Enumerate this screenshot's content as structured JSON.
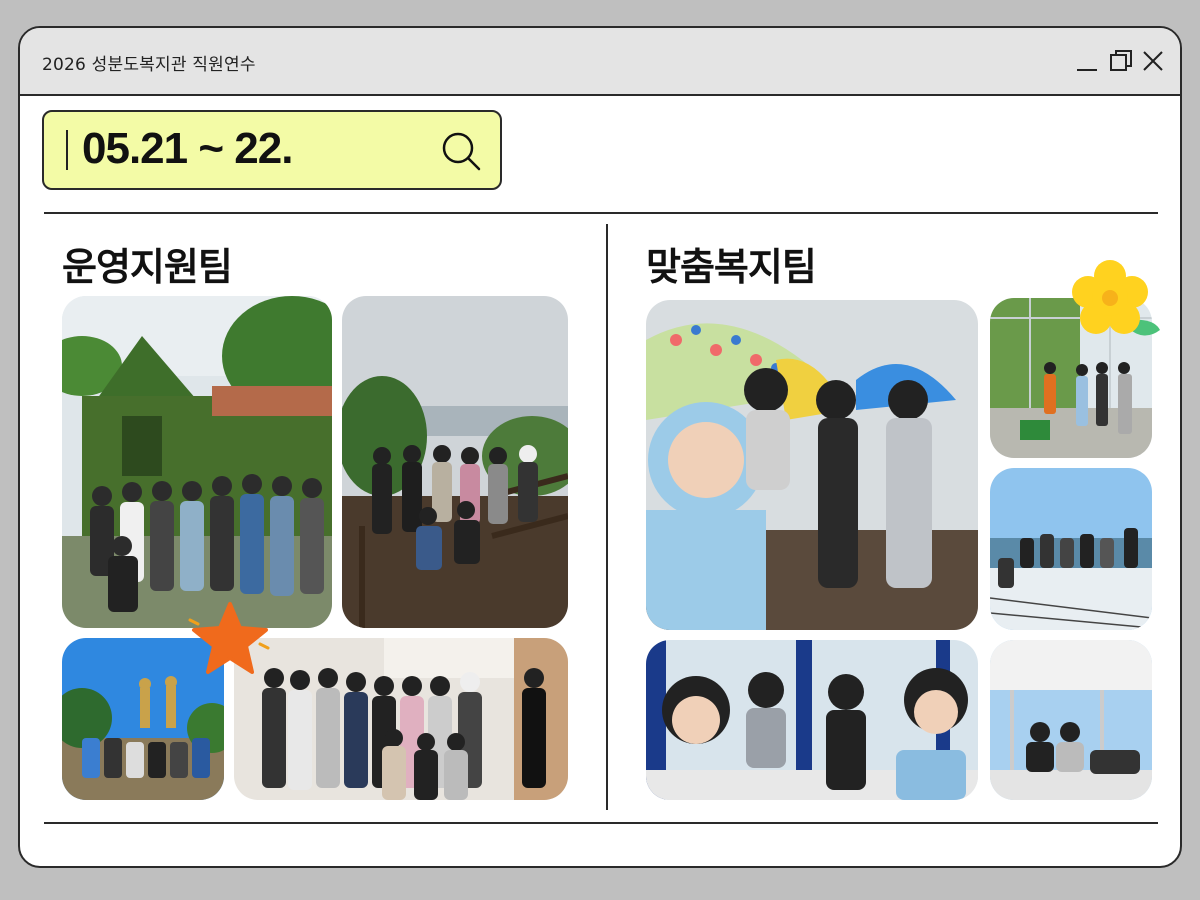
{
  "window": {
    "title": "2026 성분도복지관 직원연수"
  },
  "search": {
    "value": "05.21 ~ 22."
  },
  "sections": {
    "left": {
      "title": "운영지원팀"
    },
    "right": {
      "title": "맞춤복지팀"
    }
  },
  "icons": {
    "minimize": "minimize-icon",
    "maximize": "restore-icon",
    "close": "close-icon",
    "search": "search-icon"
  },
  "colors": {
    "search_bg": "#f3fba6",
    "titlebar_bg": "#e4e4e4",
    "star": "#f06a1c",
    "flower": "#ffd21f",
    "leaf": "#4cc27a"
  }
}
